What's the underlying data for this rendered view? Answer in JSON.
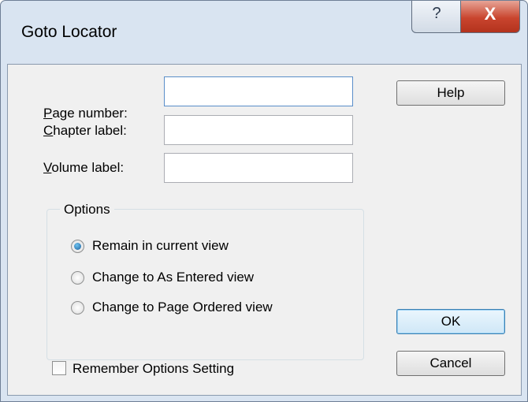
{
  "window": {
    "title": "Goto Locator",
    "help_caption_glyph": "?",
    "close_caption_glyph": "X"
  },
  "fields": {
    "page_number": {
      "label_mnemonic": "P",
      "label_rest": "age number:",
      "value": ""
    },
    "chapter_label": {
      "label_mnemonic": "C",
      "label_rest": "hapter label:",
      "value": ""
    },
    "volume_label": {
      "label_mnemonic": "V",
      "label_rest": "olume label:",
      "value": ""
    }
  },
  "options": {
    "legend": "Options",
    "selected_index": 0,
    "items": [
      {
        "label": "Remain in current view"
      },
      {
        "label": "Change to As Entered view"
      },
      {
        "label": "Change to Page Ordered view"
      }
    ]
  },
  "remember": {
    "label": "Remember Options Setting",
    "checked": false
  },
  "buttons": {
    "help": "Help",
    "ok": "OK",
    "cancel": "Cancel"
  }
}
